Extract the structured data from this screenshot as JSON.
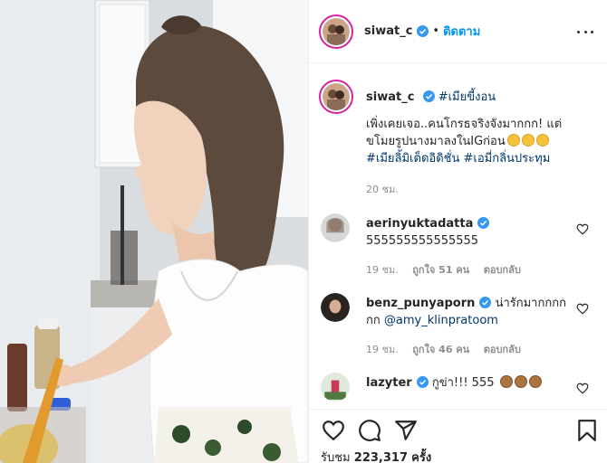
{
  "post": {
    "username": "siwat_c",
    "separator": "•",
    "follow_label": "ติดตาม",
    "more_icon": "more-options-icon"
  },
  "caption": {
    "username": "siwat_c",
    "hashtag": "#เมียขี้งอน",
    "lines": [
      "เพิ่งเคยเจอ..คนโกรธจริงจังมากกก! แต่",
      "ขโมยรูปนางมาลงในIGก่อน"
    ],
    "tags_line": "#เมียลิ้มิเต็ดอิดิชั่น #เอมี่กลิ่นประทุม",
    "time": "20 ชม."
  },
  "comments": [
    {
      "username": "aerinyuktadatta",
      "text": "555555555555555",
      "time": "19 ชม.",
      "likes": "ถูกใจ 51 คน",
      "reply": "ตอบกลับ"
    },
    {
      "username": "benz_punyaporn",
      "text": "น่ารักมากกกก",
      "text_line2": "กก",
      "mention": "@amy_klinpratoom",
      "time": "19 ชม.",
      "likes": "ถูกใจ 46 คน",
      "reply": "ตอบกลับ"
    },
    {
      "username": "lazyter",
      "text": "กูข่า!!! 555"
    }
  ],
  "views": {
    "label": "รับชม",
    "count": "223,317",
    "unit": "ครั้ง"
  },
  "colors": {
    "link_blue": "#0095f6",
    "hashtag_blue": "#00376b",
    "verified_blue": "#3897f0",
    "muted": "#8e8e8e",
    "story_ring": "#d6249f"
  }
}
